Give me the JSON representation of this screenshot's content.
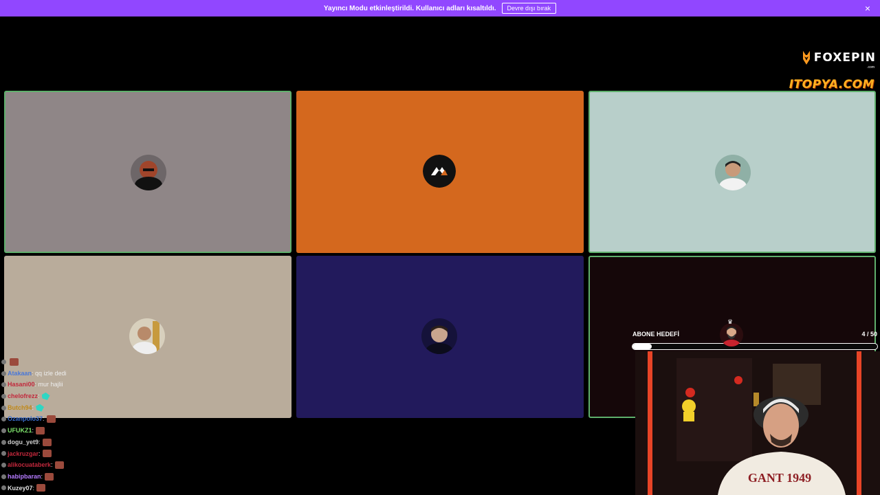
{
  "banner": {
    "text": "Yayıncı Modu etkinleştirildi. Kullanıcı adları kısaltıldı.",
    "button": "Devre dışı bırak",
    "close": "×"
  },
  "sponsors": {
    "fox": "FOXEPIN",
    "fox_domain": ".com",
    "itopya": "ITOPYA.COM"
  },
  "tiles": [
    {
      "bg": "#8f8687",
      "active": true
    },
    {
      "bg": "#d4681e",
      "active": false
    },
    {
      "bg": "#b8cfca",
      "active": true
    },
    {
      "bg": "#b9ac9b",
      "active": false
    },
    {
      "bg": "#221a5c",
      "active": false
    },
    {
      "bg": "#150709",
      "active": true
    }
  ],
  "chat": [
    {
      "name": "",
      "color": "#3a7bd5",
      "message": "",
      "emote": "red"
    },
    {
      "name": "Atakaan",
      "color": "#4a78d8",
      "message": ": qq izle dedi",
      "emote": ""
    },
    {
      "name": "Hasani00",
      "color": "#c2283c",
      "message": ": mur hajlii",
      "emote": ""
    },
    {
      "name": "chelofrezz",
      "color": "#c2283c",
      "message": ":",
      "emote": "teal"
    },
    {
      "name": "Butch94",
      "color": "#c0891a",
      "message": ":",
      "emote": "teal"
    },
    {
      "name": "Ozanpolo37",
      "color": "#3a6fd0",
      "message": ":",
      "emote": "red"
    },
    {
      "name": "UFUKZ1",
      "color": "#7ee36c",
      "message": ":",
      "emote": "red"
    },
    {
      "name": "dogu_yet9",
      "color": "#cfcfcf",
      "message": ":",
      "emote": "red"
    },
    {
      "name": "jackruzgar",
      "color": "#c2283c",
      "message": ":",
      "emote": "red"
    },
    {
      "name": "alikocuataberk",
      "color": "#c2283c",
      "message": ":",
      "emote": "red"
    },
    {
      "name": "habipbaran",
      "color": "#b57bff",
      "message": ":",
      "emote": "red"
    },
    {
      "name": "Kuzey07",
      "color": "#e0e0e0",
      "message": ":",
      "emote": "red"
    }
  ],
  "goal": {
    "label": "ABONE HEDEFİ",
    "count": "4 / 50",
    "progress": 0.08
  }
}
